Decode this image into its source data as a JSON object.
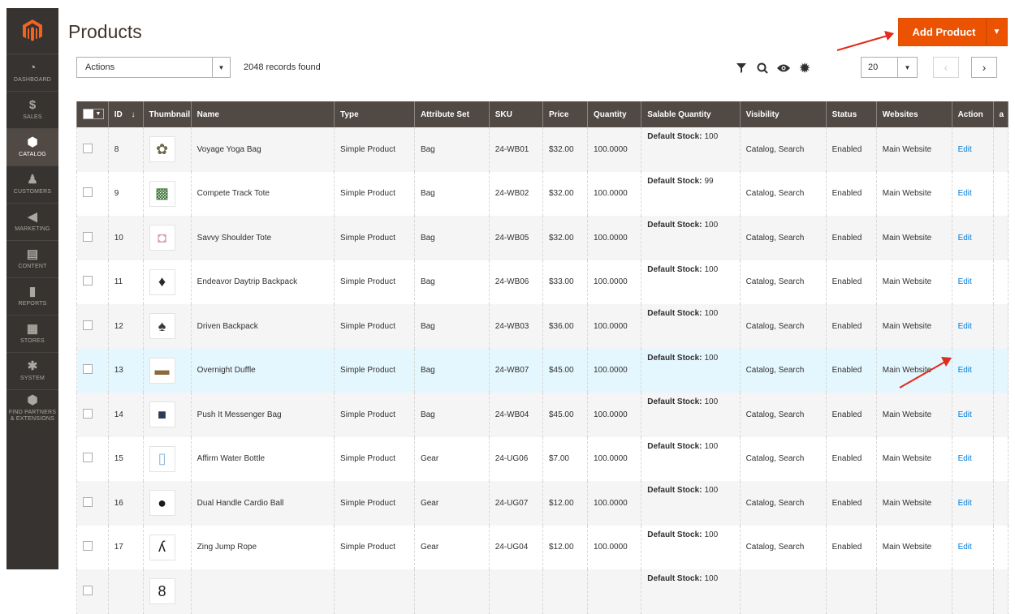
{
  "sidebar": {
    "items": [
      {
        "label": "DASHBOARD",
        "icon": "dashboard-icon",
        "glyph": "◔",
        "active": false
      },
      {
        "label": "SALES",
        "icon": "dollar-icon",
        "glyph": "$",
        "active": false
      },
      {
        "label": "CATALOG",
        "icon": "cube-icon",
        "glyph": "⬢",
        "active": true
      },
      {
        "label": "CUSTOMERS",
        "icon": "person-icon",
        "glyph": "♟",
        "active": false
      },
      {
        "label": "MARKETING",
        "icon": "megaphone-icon",
        "glyph": "◀",
        "active": false
      },
      {
        "label": "CONTENT",
        "icon": "content-icon",
        "glyph": "▤",
        "active": false
      },
      {
        "label": "REPORTS",
        "icon": "bar-chart-icon",
        "glyph": "▮",
        "active": false
      },
      {
        "label": "STORES",
        "icon": "store-icon",
        "glyph": "▦",
        "active": false
      },
      {
        "label": "SYSTEM",
        "icon": "gear-icon",
        "glyph": "✱",
        "active": false
      },
      {
        "label": "FIND PARTNERS & EXTENSIONS",
        "icon": "partners-icon",
        "glyph": "⬢",
        "active": false
      }
    ]
  },
  "header": {
    "title": "Products",
    "add_button": "Add Product",
    "accent": "#eb5202"
  },
  "toolbar": {
    "actions_label": "Actions",
    "records": "2048 records found",
    "per_page": "20"
  },
  "table": {
    "columns": [
      "ID",
      "Thumbnail",
      "Name",
      "Type",
      "Attribute Set",
      "SKU",
      "Price",
      "Quantity",
      "Salable Quantity",
      "Visibility",
      "Status",
      "Websites",
      "Action",
      "a"
    ],
    "sort_indicator": "↓",
    "rows": [
      {
        "id": "8",
        "name": "Voyage Yoga Bag",
        "type": "Simple Product",
        "attr": "Bag",
        "sku": "24-WB01",
        "price": "$32.00",
        "qty": "100.0000",
        "salable_label": "Default Stock:",
        "salable_value": "100",
        "visibility": "Catalog, Search",
        "status": "Enabled",
        "website": "Main Website",
        "action": "Edit",
        "thumb_color": "#6b6a4a",
        "thumb_glyph": "✿"
      },
      {
        "id": "9",
        "name": "Compete Track Tote",
        "type": "Simple Product",
        "attr": "Bag",
        "sku": "24-WB02",
        "price": "$32.00",
        "qty": "100.0000",
        "salable_label": "Default Stock:",
        "salable_value": "99",
        "visibility": "Catalog, Search",
        "status": "Enabled",
        "website": "Main Website",
        "action": "Edit",
        "thumb_color": "#2f6b2a",
        "thumb_glyph": "▩"
      },
      {
        "id": "10",
        "name": "Savvy Shoulder Tote",
        "type": "Simple Product",
        "attr": "Bag",
        "sku": "24-WB05",
        "price": "$32.00",
        "qty": "100.0000",
        "salable_label": "Default Stock:",
        "salable_value": "100",
        "visibility": "Catalog, Search",
        "status": "Enabled",
        "website": "Main Website",
        "action": "Edit",
        "thumb_color": "#d9a0a6",
        "thumb_glyph": "◘"
      },
      {
        "id": "11",
        "name": "Endeavor Daytrip Backpack",
        "type": "Simple Product",
        "attr": "Bag",
        "sku": "24-WB06",
        "price": "$33.00",
        "qty": "100.0000",
        "salable_label": "Default Stock:",
        "salable_value": "100",
        "visibility": "Catalog, Search",
        "status": "Enabled",
        "website": "Main Website",
        "action": "Edit",
        "thumb_color": "#2a2a2a",
        "thumb_glyph": "♦"
      },
      {
        "id": "12",
        "name": "Driven Backpack",
        "type": "Simple Product",
        "attr": "Bag",
        "sku": "24-WB03",
        "price": "$36.00",
        "qty": "100.0000",
        "salable_label": "Default Stock:",
        "salable_value": "100",
        "visibility": "Catalog, Search",
        "status": "Enabled",
        "website": "Main Website",
        "action": "Edit",
        "thumb_color": "#3a3a3a",
        "thumb_glyph": "♠"
      },
      {
        "id": "13",
        "name": "Overnight Duffle",
        "type": "Simple Product",
        "attr": "Bag",
        "sku": "24-WB07",
        "price": "$45.00",
        "qty": "100.0000",
        "salable_label": "Default Stock:",
        "salable_value": "100",
        "visibility": "Catalog, Search",
        "status": "Enabled",
        "website": "Main Website",
        "action": "Edit",
        "thumb_color": "#8a6a3a",
        "thumb_glyph": "▬"
      },
      {
        "id": "14",
        "name": "Push It Messenger Bag",
        "type": "Simple Product",
        "attr": "Bag",
        "sku": "24-WB04",
        "price": "$45.00",
        "qty": "100.0000",
        "salable_label": "Default Stock:",
        "salable_value": "100",
        "visibility": "Catalog, Search",
        "status": "Enabled",
        "website": "Main Website",
        "action": "Edit",
        "thumb_color": "#2b3a55",
        "thumb_glyph": "■"
      },
      {
        "id": "15",
        "name": "Affirm Water Bottle",
        "type": "Simple Product",
        "attr": "Gear",
        "sku": "24-UG06",
        "price": "$7.00",
        "qty": "100.0000",
        "salable_label": "Default Stock:",
        "salable_value": "100",
        "visibility": "Catalog, Search",
        "status": "Enabled",
        "website": "Main Website",
        "action": "Edit",
        "thumb_color": "#8ab4d8",
        "thumb_glyph": "▯"
      },
      {
        "id": "16",
        "name": "Dual Handle Cardio Ball",
        "type": "Simple Product",
        "attr": "Gear",
        "sku": "24-UG07",
        "price": "$12.00",
        "qty": "100.0000",
        "salable_label": "Default Stock:",
        "salable_value": "100",
        "visibility": "Catalog, Search",
        "status": "Enabled",
        "website": "Main Website",
        "action": "Edit",
        "thumb_color": "#1a1a1a",
        "thumb_glyph": "●"
      },
      {
        "id": "17",
        "name": "Zing Jump Rope",
        "type": "Simple Product",
        "attr": "Gear",
        "sku": "24-UG04",
        "price": "$12.00",
        "qty": "100.0000",
        "salable_label": "Default Stock:",
        "salable_value": "100",
        "visibility": "Catalog, Search",
        "status": "Enabled",
        "website": "Main Website",
        "action": "Edit",
        "thumb_color": "#1a1a1a",
        "thumb_glyph": "ʎ"
      },
      {
        "id": "",
        "name": "",
        "type": "",
        "attr": "",
        "sku": "",
        "price": "",
        "qty": "",
        "salable_label": "Default Stock:",
        "salable_value": "100",
        "visibility": "",
        "status": "",
        "website": "",
        "action": "",
        "thumb_color": "#1a1a1a",
        "thumb_glyph": "8"
      }
    ]
  }
}
